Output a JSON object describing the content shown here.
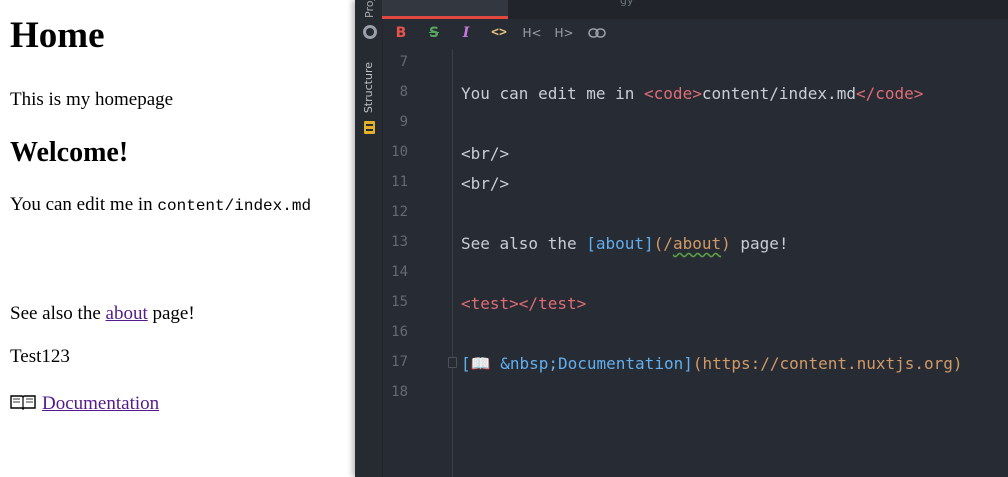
{
  "preview": {
    "heading": "Home",
    "intro": "This is my homepage",
    "subheading": "Welcome!",
    "edit_text": "You can edit me in ",
    "edit_code": "content/index.md",
    "see_prefix": "See also the ",
    "see_link": "about",
    "see_suffix": " page!",
    "test_text": "Test123",
    "docs_link": "Documentation",
    "docs_icon": "open-book-icon"
  },
  "editor": {
    "side_panels": {
      "project": "Project",
      "structure": "Structure"
    },
    "tab_rest_label": "gy",
    "toolbar": {
      "logo_icon": "markdown-logo-icon",
      "bold": "B",
      "strikethrough": "S",
      "italic": "I",
      "code": "<>",
      "header_decrease": "H<",
      "header_increase": "H>",
      "link_icon": "link-icon"
    },
    "lines": [
      {
        "num": "7",
        "segments": []
      },
      {
        "num": "8",
        "segments": [
          {
            "t": "You can edit me in ",
            "c": "plain"
          },
          {
            "t": "<code>",
            "c": "tag"
          },
          {
            "t": "content/index.md",
            "c": "plain"
          },
          {
            "t": "</code>",
            "c": "tag"
          }
        ]
      },
      {
        "num": "9",
        "segments": []
      },
      {
        "num": "10",
        "segments": [
          {
            "t": "<br/>",
            "c": "plain"
          }
        ]
      },
      {
        "num": "11",
        "segments": [
          {
            "t": "<br/>",
            "c": "plain"
          }
        ]
      },
      {
        "num": "12",
        "segments": []
      },
      {
        "num": "13",
        "segments": [
          {
            "t": "See also the ",
            "c": "plain"
          },
          {
            "t": "[about]",
            "c": "link"
          },
          {
            "t": "(/",
            "c": "url"
          },
          {
            "t": "about",
            "c": "url squig"
          },
          {
            "t": ")",
            "c": "url"
          },
          {
            "t": " page!",
            "c": "plain"
          }
        ]
      },
      {
        "num": "14",
        "segments": []
      },
      {
        "num": "15",
        "segments": [
          {
            "t": "<test>",
            "c": "tag"
          },
          {
            "t": "</test>",
            "c": "tag"
          }
        ]
      },
      {
        "num": "16",
        "segments": []
      },
      {
        "num": "17",
        "segments": [
          {
            "t": "[📖 &nbsp;Documentation]",
            "c": "link"
          },
          {
            "t": "(https://content.nuxtjs.org)",
            "c": "url"
          }
        ]
      },
      {
        "num": "18",
        "segments": []
      }
    ]
  },
  "colors": {
    "editor_bg": "#272b33",
    "tag": "#e06c75",
    "link": "#61afef",
    "url": "#d19a66",
    "active_tab_accent": "#e2483d",
    "visited_link": "#551a8b"
  }
}
